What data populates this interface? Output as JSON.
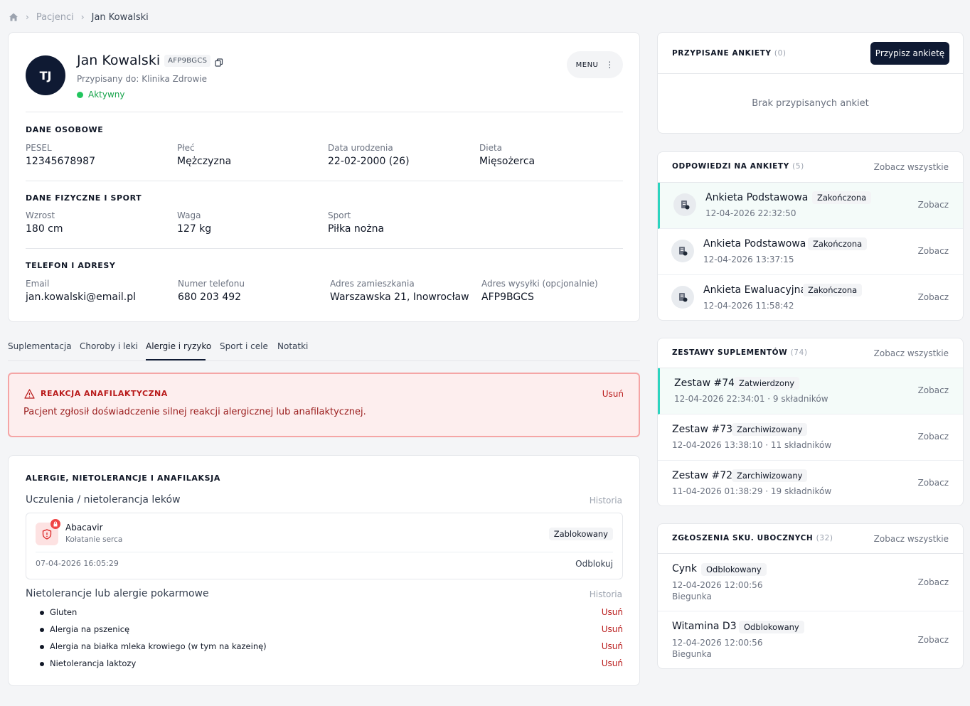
{
  "breadcrumb": {
    "home_icon": "home-icon",
    "items": [
      "Pacjenci",
      "Jan Kowalski"
    ]
  },
  "patient": {
    "initials": "TJ",
    "name": "Jan Kowalski",
    "code": "AFP9BGCS",
    "assigned": "Przypisany do: Klinika Zdrowie",
    "status": "Aktywny",
    "status_color": "#22c55e",
    "menu_label": "MENU"
  },
  "personal": {
    "title": "DANE OSOBOWE",
    "fields": [
      {
        "label": "PESEL",
        "value": "12345678987"
      },
      {
        "label": "Płeć",
        "value": "Mężczyzna"
      },
      {
        "label": "Data urodzenia",
        "value": "22-02-2000 (26)"
      },
      {
        "label": "Dieta",
        "value": "Mięsożerca"
      }
    ]
  },
  "physical": {
    "title": "DANE FIZYCZNE I SPORT",
    "fields": [
      {
        "label": "Wzrost",
        "value": "180 cm"
      },
      {
        "label": "Waga",
        "value": "127 kg"
      },
      {
        "label": "Sport",
        "value": "Piłka nożna"
      }
    ]
  },
  "contact": {
    "title": "TELEFON I ADRESY",
    "fields": [
      {
        "label": "Email",
        "value": "jan.kowalski@email.pl"
      },
      {
        "label": "Numer telefonu",
        "value": "680 203 492"
      },
      {
        "label": "Adres zamieszkania",
        "value": "Warszawska 21, Inowrocław"
      },
      {
        "label": "Adres wysyłki (opcjonalnie)",
        "value": "AFP9BGCS"
      }
    ]
  },
  "tabs": [
    "Suplementacja",
    "Choroby i leki",
    "Alergie i ryzyko",
    "Sport i cele",
    "Notatki"
  ],
  "alert": {
    "title": "REAKCJA ANAFILAKTYCZNA",
    "remove": "Usuń",
    "text": "Pacjent zgłosił doświadczenie silnej reakcji alergicznej lub anafilaktycznej.",
    "color": "#b91c1c"
  },
  "allergies": {
    "title": "ALERGIE, NIETOLERANCJE I ANAFILAKSJA",
    "drugs_title": "Uczulenia / nietolerancja leków",
    "history": "Historia",
    "drug": {
      "name": "Abacavir",
      "reaction": "Kołatanie serca",
      "status": "Zablokowany",
      "date": "07-04-2026 16:05:29",
      "unblock": "Odblokuj"
    },
    "food_title": "Nietolerancje lub alergie pokarmowe",
    "food_history": "Historia",
    "food_items": [
      {
        "name": "Gluten",
        "remove": "Usuń"
      },
      {
        "name": "Alergia na pszenicę",
        "remove": "Usuń"
      },
      {
        "name": "Alergia na białka mleka krowiego (w tym na kazeinę)",
        "remove": "Usuń"
      },
      {
        "name": "Nietolerancja laktozy",
        "remove": "Usuń"
      }
    ]
  },
  "assigned_surveys": {
    "title": "PRZYPISANE ANKIETY",
    "count": "(0)",
    "button": "Przypisz ankietę",
    "empty": "Brak przypisanych ankiet"
  },
  "survey_answers": {
    "title": "ODPOWIEDZI NA ANKIETY",
    "count": "(5)",
    "see_all": "Zobacz wszystkie",
    "items": [
      {
        "name": "Ankieta Podstawowa",
        "status": "Zakończona",
        "date": "12-04-2026 22:32:50",
        "action": "Zobacz"
      },
      {
        "name": "Ankieta Podstawowa",
        "status": "Zakończona",
        "date": "12-04-2026 13:37:15",
        "action": "Zobacz"
      },
      {
        "name": "Ankieta Ewaluacyjna",
        "status": "Zakończona",
        "date": "12-04-2026 11:58:42",
        "action": "Zobacz"
      }
    ]
  },
  "supplement_sets": {
    "title": "ZESTAWY SUPLEMENTÓW",
    "count": "(74)",
    "see_all": "Zobacz wszystkie",
    "items": [
      {
        "name": "Zestaw #74",
        "status": "Zatwierdzony",
        "meta": "12-04-2026 22:34:01 · 9 składników",
        "action": "Zobacz"
      },
      {
        "name": "Zestaw #73",
        "status": "Zarchiwizowany",
        "meta": "12-04-2026 13:38:10 · 11 składników",
        "action": "Zobacz"
      },
      {
        "name": "Zestaw #72",
        "status": "Zarchiwizowany",
        "meta": "11-04-2026 01:38:29 · 19 składników",
        "action": "Zobacz"
      }
    ]
  },
  "side_effects": {
    "title": "ZGŁOSZENIA SKU. UBOCZNYCH",
    "count": "(32)",
    "see_all": "Zobacz wszystkie",
    "items": [
      {
        "name": "Cynk",
        "status": "Odblokowany",
        "date": "12-04-2026 12:00:56",
        "sub": "Biegunka",
        "action": "Zobacz"
      },
      {
        "name": "Witamina D3",
        "status": "Odblokowany",
        "date": "12-04-2026 12:00:56",
        "sub": "Biegunka",
        "action": "Zobacz"
      }
    ]
  },
  "accent_color": "#2dd4bf"
}
